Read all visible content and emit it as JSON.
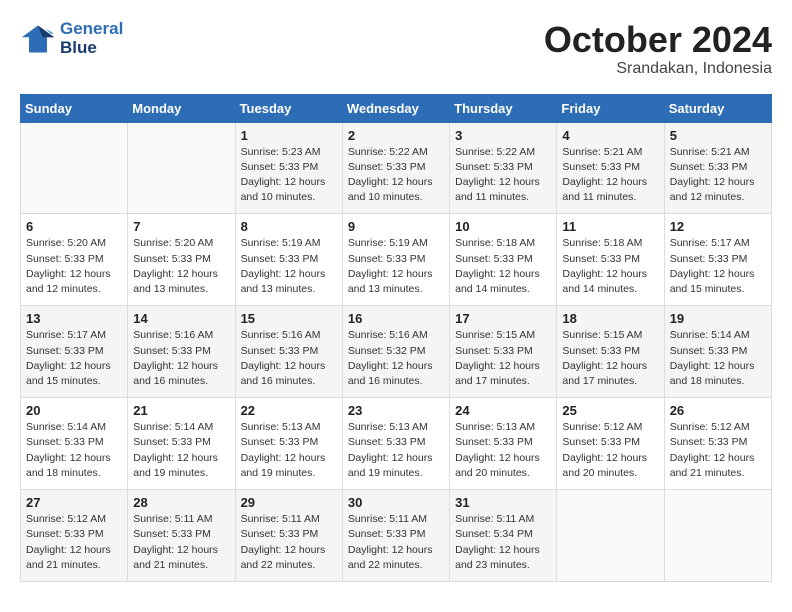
{
  "header": {
    "logo_line1": "General",
    "logo_line2": "Blue",
    "month_title": "October 2024",
    "subtitle": "Srandakan, Indonesia"
  },
  "weekdays": [
    "Sunday",
    "Monday",
    "Tuesday",
    "Wednesday",
    "Thursday",
    "Friday",
    "Saturday"
  ],
  "weeks": [
    [
      {
        "day": "",
        "info": ""
      },
      {
        "day": "",
        "info": ""
      },
      {
        "day": "1",
        "info": "Sunrise: 5:23 AM\nSunset: 5:33 PM\nDaylight: 12 hours\nand 10 minutes."
      },
      {
        "day": "2",
        "info": "Sunrise: 5:22 AM\nSunset: 5:33 PM\nDaylight: 12 hours\nand 10 minutes."
      },
      {
        "day": "3",
        "info": "Sunrise: 5:22 AM\nSunset: 5:33 PM\nDaylight: 12 hours\nand 11 minutes."
      },
      {
        "day": "4",
        "info": "Sunrise: 5:21 AM\nSunset: 5:33 PM\nDaylight: 12 hours\nand 11 minutes."
      },
      {
        "day": "5",
        "info": "Sunrise: 5:21 AM\nSunset: 5:33 PM\nDaylight: 12 hours\nand 12 minutes."
      }
    ],
    [
      {
        "day": "6",
        "info": "Sunrise: 5:20 AM\nSunset: 5:33 PM\nDaylight: 12 hours\nand 12 minutes."
      },
      {
        "day": "7",
        "info": "Sunrise: 5:20 AM\nSunset: 5:33 PM\nDaylight: 12 hours\nand 13 minutes."
      },
      {
        "day": "8",
        "info": "Sunrise: 5:19 AM\nSunset: 5:33 PM\nDaylight: 12 hours\nand 13 minutes."
      },
      {
        "day": "9",
        "info": "Sunrise: 5:19 AM\nSunset: 5:33 PM\nDaylight: 12 hours\nand 13 minutes."
      },
      {
        "day": "10",
        "info": "Sunrise: 5:18 AM\nSunset: 5:33 PM\nDaylight: 12 hours\nand 14 minutes."
      },
      {
        "day": "11",
        "info": "Sunrise: 5:18 AM\nSunset: 5:33 PM\nDaylight: 12 hours\nand 14 minutes."
      },
      {
        "day": "12",
        "info": "Sunrise: 5:17 AM\nSunset: 5:33 PM\nDaylight: 12 hours\nand 15 minutes."
      }
    ],
    [
      {
        "day": "13",
        "info": "Sunrise: 5:17 AM\nSunset: 5:33 PM\nDaylight: 12 hours\nand 15 minutes."
      },
      {
        "day": "14",
        "info": "Sunrise: 5:16 AM\nSunset: 5:33 PM\nDaylight: 12 hours\nand 16 minutes."
      },
      {
        "day": "15",
        "info": "Sunrise: 5:16 AM\nSunset: 5:33 PM\nDaylight: 12 hours\nand 16 minutes."
      },
      {
        "day": "16",
        "info": "Sunrise: 5:16 AM\nSunset: 5:32 PM\nDaylight: 12 hours\nand 16 minutes."
      },
      {
        "day": "17",
        "info": "Sunrise: 5:15 AM\nSunset: 5:33 PM\nDaylight: 12 hours\nand 17 minutes."
      },
      {
        "day": "18",
        "info": "Sunrise: 5:15 AM\nSunset: 5:33 PM\nDaylight: 12 hours\nand 17 minutes."
      },
      {
        "day": "19",
        "info": "Sunrise: 5:14 AM\nSunset: 5:33 PM\nDaylight: 12 hours\nand 18 minutes."
      }
    ],
    [
      {
        "day": "20",
        "info": "Sunrise: 5:14 AM\nSunset: 5:33 PM\nDaylight: 12 hours\nand 18 minutes."
      },
      {
        "day": "21",
        "info": "Sunrise: 5:14 AM\nSunset: 5:33 PM\nDaylight: 12 hours\nand 19 minutes."
      },
      {
        "day": "22",
        "info": "Sunrise: 5:13 AM\nSunset: 5:33 PM\nDaylight: 12 hours\nand 19 minutes."
      },
      {
        "day": "23",
        "info": "Sunrise: 5:13 AM\nSunset: 5:33 PM\nDaylight: 12 hours\nand 19 minutes."
      },
      {
        "day": "24",
        "info": "Sunrise: 5:13 AM\nSunset: 5:33 PM\nDaylight: 12 hours\nand 20 minutes."
      },
      {
        "day": "25",
        "info": "Sunrise: 5:12 AM\nSunset: 5:33 PM\nDaylight: 12 hours\nand 20 minutes."
      },
      {
        "day": "26",
        "info": "Sunrise: 5:12 AM\nSunset: 5:33 PM\nDaylight: 12 hours\nand 21 minutes."
      }
    ],
    [
      {
        "day": "27",
        "info": "Sunrise: 5:12 AM\nSunset: 5:33 PM\nDaylight: 12 hours\nand 21 minutes."
      },
      {
        "day": "28",
        "info": "Sunrise: 5:11 AM\nSunset: 5:33 PM\nDaylight: 12 hours\nand 21 minutes."
      },
      {
        "day": "29",
        "info": "Sunrise: 5:11 AM\nSunset: 5:33 PM\nDaylight: 12 hours\nand 22 minutes."
      },
      {
        "day": "30",
        "info": "Sunrise: 5:11 AM\nSunset: 5:33 PM\nDaylight: 12 hours\nand 22 minutes."
      },
      {
        "day": "31",
        "info": "Sunrise: 5:11 AM\nSunset: 5:34 PM\nDaylight: 12 hours\nand 23 minutes."
      },
      {
        "day": "",
        "info": ""
      },
      {
        "day": "",
        "info": ""
      }
    ]
  ]
}
